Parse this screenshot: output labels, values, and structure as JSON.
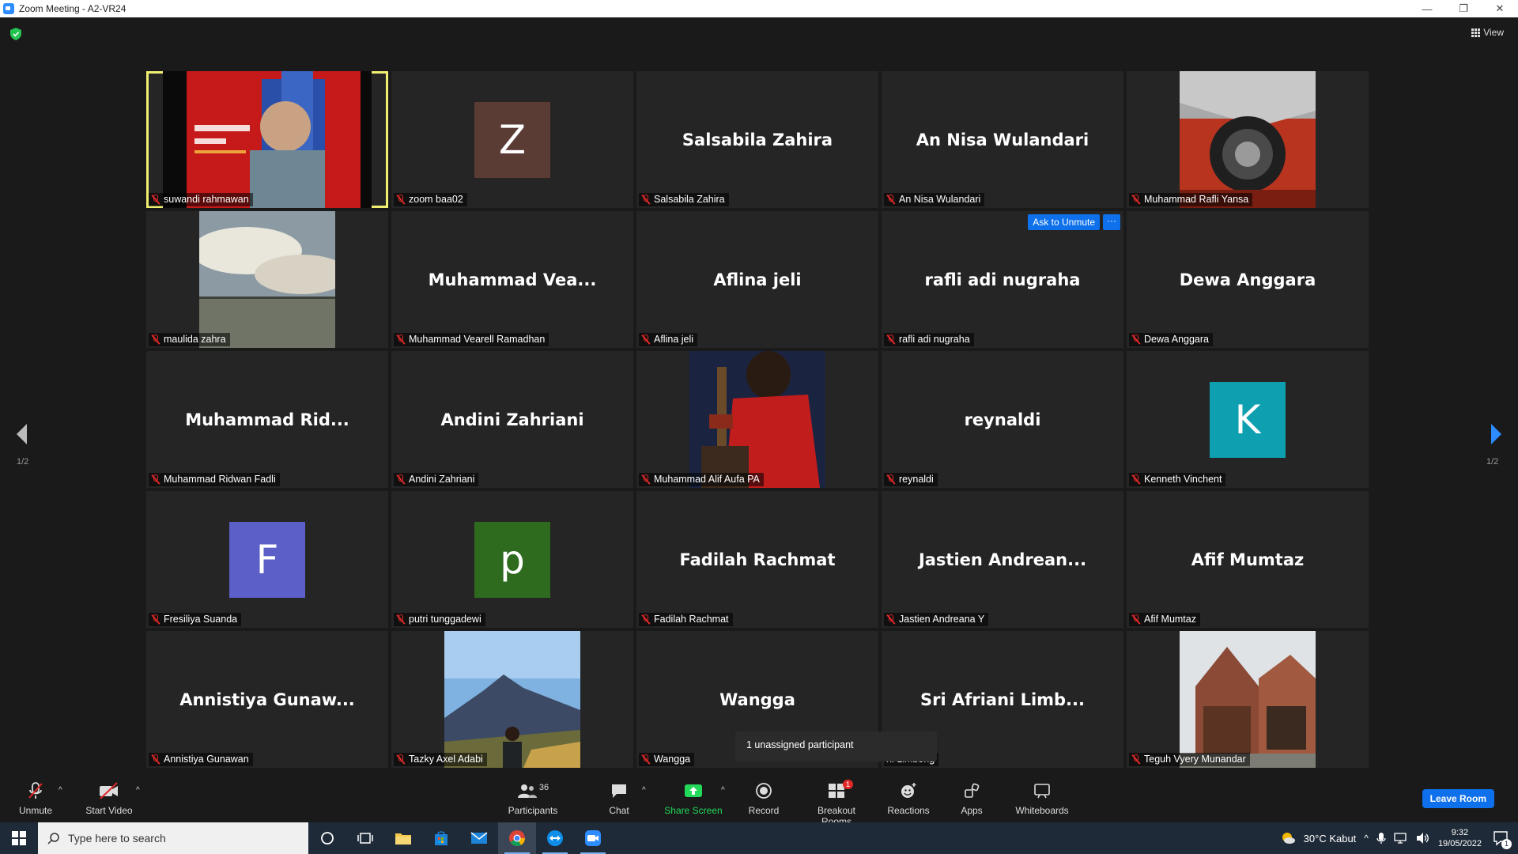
{
  "window": {
    "title": "Zoom Meeting - A2-VR24",
    "minimize": "—",
    "restore": "❐",
    "close": "✕"
  },
  "header": {
    "view_label": "View"
  },
  "pager": {
    "left": "1/2",
    "right": "1/2"
  },
  "ask_unmute": {
    "label": "Ask to Unmute",
    "more": "···"
  },
  "popup": {
    "text": "1 unassigned participant"
  },
  "tiles": [
    {
      "name": "suwandi rahmawan",
      "kind": "video",
      "active": true
    },
    {
      "name": "zoom baa02",
      "kind": "avatar",
      "letter": "Z",
      "color": "#5b3c35"
    },
    {
      "name": "Salsabila Zahira",
      "kind": "text",
      "display": "Salsabila Zahira"
    },
    {
      "name": "An Nisa Wulandari",
      "kind": "text",
      "display": "An Nisa Wulandari"
    },
    {
      "name": "Muhammad Rafli Yansa",
      "kind": "video"
    },
    {
      "name": "maulida zahra",
      "kind": "video"
    },
    {
      "name": "Muhammad Vearell Ramadhan",
      "kind": "text",
      "display": "Muhammad  Vea..."
    },
    {
      "name": "Aflina jeli",
      "kind": "text",
      "display": "Aflina jeli"
    },
    {
      "name": "rafli adi nugraha",
      "kind": "text",
      "display": "rafli adi nugraha"
    },
    {
      "name": "Dewa Anggara",
      "kind": "text",
      "display": "Dewa Anggara"
    },
    {
      "name": "Muhammad Ridwan Fadli",
      "kind": "text",
      "display": "Muhammad  Rid..."
    },
    {
      "name": "Andini Zahriani",
      "kind": "text",
      "display": "Andini Zahriani"
    },
    {
      "name": "Muhammad Alif Aufa PA",
      "kind": "video"
    },
    {
      "name": "reynaldi",
      "kind": "text",
      "display": "reynaldi"
    },
    {
      "name": "Kenneth Vinchent",
      "kind": "avatar",
      "letter": "K",
      "color": "#0e9fb1"
    },
    {
      "name": "Fresiliya Suanda",
      "kind": "avatar",
      "letter": "F",
      "color": "#5b5fc7"
    },
    {
      "name": "putri tunggadewi",
      "kind": "avatar",
      "letter": "p",
      "color": "#2e6b1f"
    },
    {
      "name": "Fadilah Rachmat",
      "kind": "text",
      "display": "Fadilah Rachmat"
    },
    {
      "name": "Jastien Andreana Y",
      "kind": "text",
      "display": "Jastien  Andrean..."
    },
    {
      "name": "Afif Mumtaz",
      "kind": "text",
      "display": "Afif Mumtaz"
    },
    {
      "name": "Annistiya Gunawan",
      "kind": "text",
      "display": "Annistiya  Gunaw..."
    },
    {
      "name": "Tazky Axel Adabi",
      "kind": "video"
    },
    {
      "name": "Wangga",
      "kind": "text",
      "display": "Wangga"
    },
    {
      "name": "ni Limbong",
      "kind": "text",
      "display": "Sri  Afriani  Limb..."
    },
    {
      "name": "Teguh Vyery Munandar",
      "kind": "video"
    }
  ],
  "toolbar": {
    "unmute": "Unmute",
    "start_video": "Start Video",
    "participants": "Participants",
    "participants_count": "36",
    "chat": "Chat",
    "share_screen": "Share Screen",
    "record": "Record",
    "breakout_rooms": "Breakout Rooms",
    "breakout_badge": "1",
    "reactions": "Reactions",
    "apps": "Apps",
    "whiteboards": "Whiteboards",
    "leave": "Leave Room"
  },
  "taskbar": {
    "search_placeholder": "Type here to search",
    "weather": "30°C  Kabut",
    "time": "9:32",
    "date": "19/05/2022",
    "notif_count": "1"
  },
  "colors": {
    "active_speaker": "#f0ef71",
    "zoom_blue": "#0e71eb",
    "muted_red": "#e02828",
    "share_green": "#23d959"
  }
}
